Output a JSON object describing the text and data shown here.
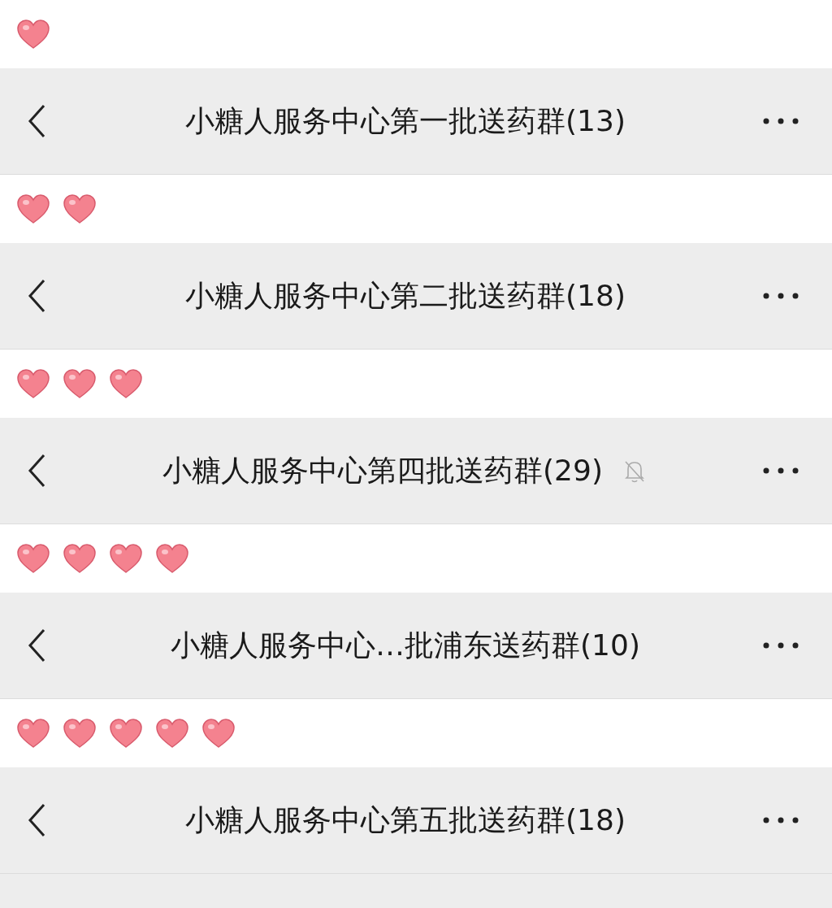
{
  "chats": [
    {
      "hearts": [
        {
          "kind": "heart"
        }
      ],
      "title": "小糖人服务中心第一批送药群(13)",
      "muted": false
    },
    {
      "hearts": [
        {
          "kind": "heart"
        },
        {
          "kind": "heart"
        }
      ],
      "title": "小糖人服务中心第二批送药群(18)",
      "muted": false
    },
    {
      "hearts": [
        {
          "kind": "heart"
        },
        {
          "kind": "heart"
        },
        {
          "kind": "heart"
        }
      ],
      "title": "小糖人服务中心第四批送药群(29)",
      "muted": true
    },
    {
      "hearts": [
        {
          "kind": "heart"
        },
        {
          "kind": "heart"
        },
        {
          "kind": "heart"
        },
        {
          "kind": "heart"
        }
      ],
      "title": "小糖人服务中心…批浦东送药群(10)",
      "muted": false
    },
    {
      "hearts": [
        {
          "kind": "heart"
        },
        {
          "kind": "heart"
        },
        {
          "kind": "heart"
        },
        {
          "kind": "heart"
        },
        {
          "kind": "heart"
        }
      ],
      "title": "小糖人服务中心第五批送药群(18)",
      "muted": false
    }
  ]
}
